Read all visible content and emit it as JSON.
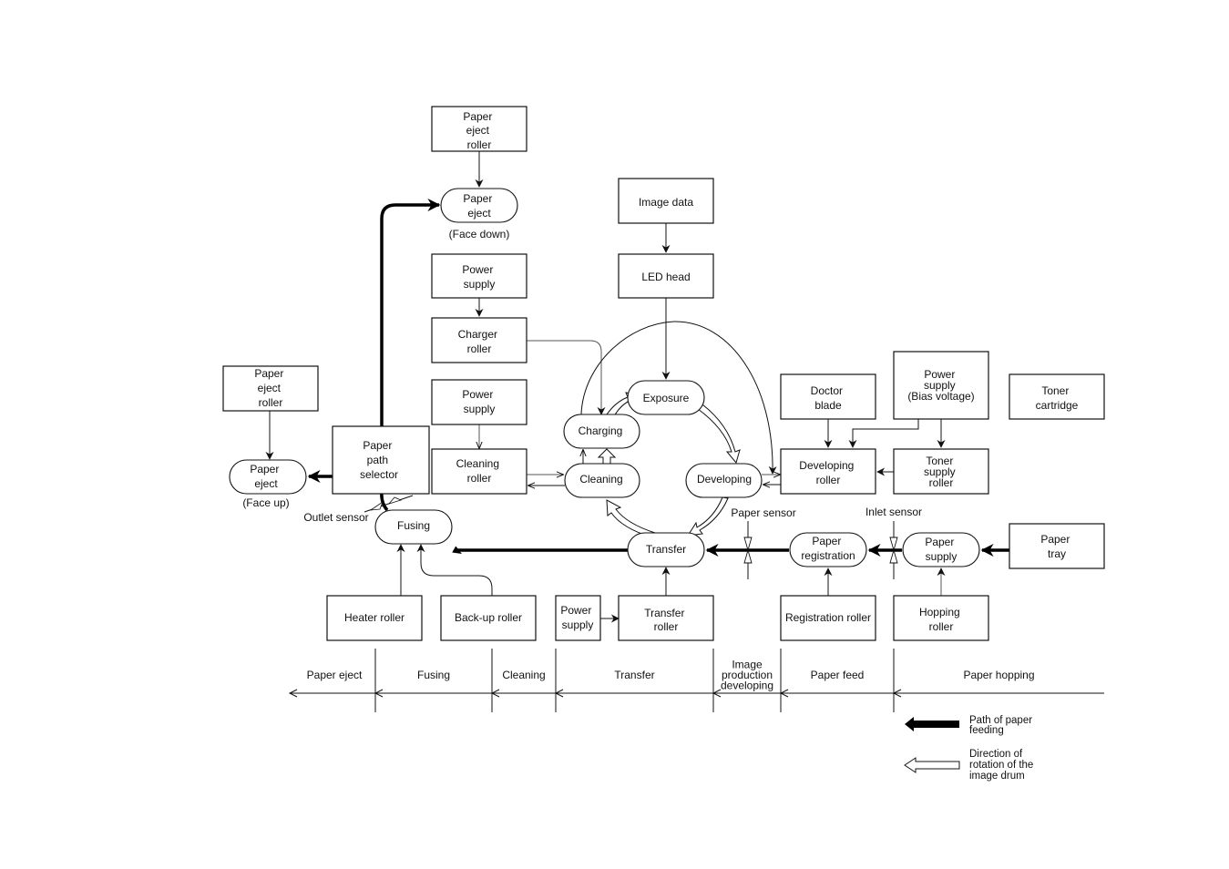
{
  "boxes": {
    "paper_eject_roller_top": [
      "Paper",
      "eject",
      "roller"
    ],
    "paper_eject_roller_left": [
      "Paper",
      "eject",
      "roller"
    ],
    "power_supply_charger": [
      "Power",
      "supply"
    ],
    "charger_roller": [
      "Charger",
      "roller"
    ],
    "power_supply_cleaning": [
      "Power",
      "supply"
    ],
    "cleaning_roller": [
      "Cleaning",
      "roller"
    ],
    "paper_path_selector": [
      "Paper",
      "path",
      "selector"
    ],
    "image_data": [
      "Image data"
    ],
    "led_head": [
      "LED head"
    ],
    "doctor_blade": [
      "Doctor",
      "blade"
    ],
    "power_supply_bias": [
      "Power",
      "supply",
      "(Bias voltage)"
    ],
    "toner_cartridge": [
      "Toner",
      "cartridge"
    ],
    "developing_roller": [
      "Developing",
      "roller"
    ],
    "toner_supply_roller": [
      "Toner",
      "supply",
      "roller"
    ],
    "paper_tray": [
      "Paper",
      "tray"
    ],
    "heater_roller": [
      "Heater roller"
    ],
    "backup_roller": [
      "Back-up roller"
    ],
    "power_supply_transfer": [
      "Power",
      "supply"
    ],
    "transfer_roller": [
      "Transfer",
      "roller"
    ],
    "registration_roller": [
      "Registration roller"
    ],
    "hopping_roller": [
      "Hopping",
      "roller"
    ]
  },
  "processes": {
    "paper_eject_face_down": [
      "Paper",
      "eject"
    ],
    "paper_eject_face_up": [
      "Paper",
      "eject"
    ],
    "charging": [
      "Charging"
    ],
    "exposure": [
      "Exposure"
    ],
    "cleaning": [
      "Cleaning"
    ],
    "developing": [
      "Developing"
    ],
    "transfer": [
      "Transfer"
    ],
    "fusing": [
      "Fusing"
    ],
    "paper_registration": [
      "Paper",
      "registration"
    ],
    "paper_supply": [
      "Paper",
      "supply"
    ]
  },
  "labels": {
    "face_down": "(Face down)",
    "face_up": "(Face up)",
    "outlet_sensor": "Outlet sensor",
    "paper_sensor": "Paper sensor",
    "inlet_sensor": "Inlet sensor"
  },
  "stages": [
    {
      "lines": [
        "Paper eject"
      ]
    },
    {
      "lines": [
        "Fusing"
      ]
    },
    {
      "lines": [
        "Cleaning"
      ]
    },
    {
      "lines": [
        "Transfer"
      ]
    },
    {
      "lines": [
        "Image",
        "production",
        "developing"
      ]
    },
    {
      "lines": [
        "Paper feed"
      ]
    },
    {
      "lines": [
        "Paper hopping"
      ]
    }
  ],
  "legend": {
    "paper_path": [
      "Path of paper",
      "feeding"
    ],
    "drum_rotation": [
      "Direction of",
      "rotation of the",
      "image drum"
    ]
  }
}
